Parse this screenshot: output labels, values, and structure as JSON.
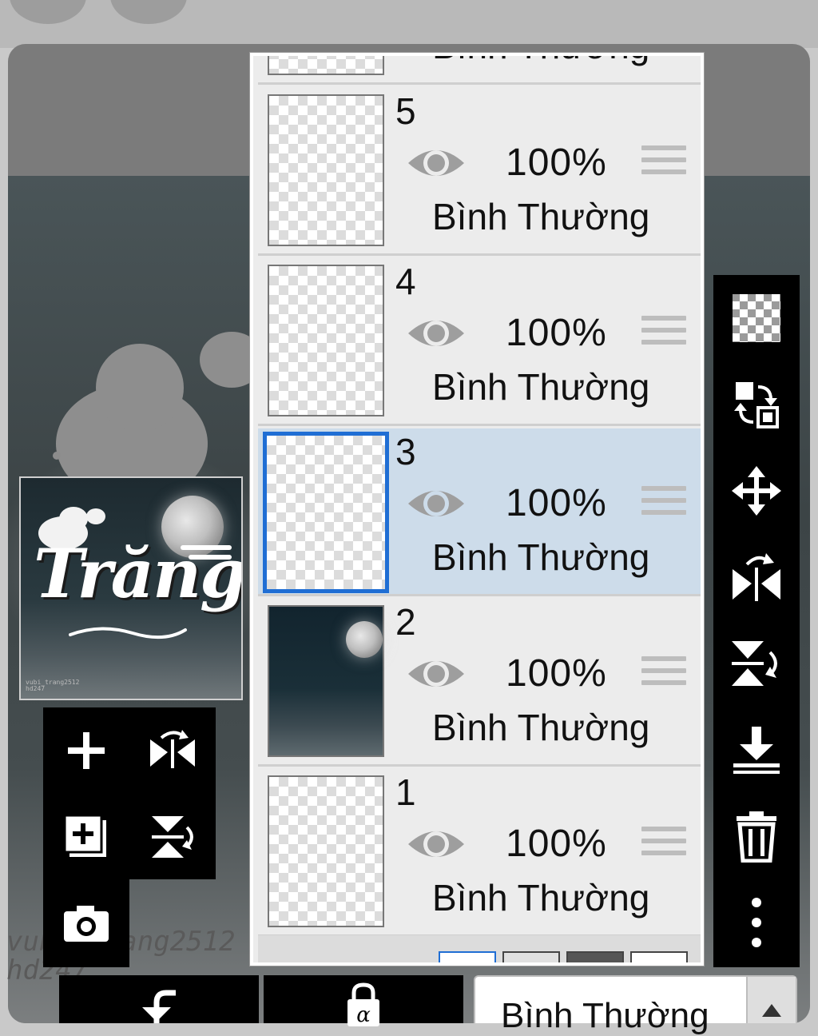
{
  "layers": [
    {
      "number": "5",
      "opacity": "100%",
      "blend": "Bình Thường",
      "visible": true,
      "selected": false
    },
    {
      "number": "4",
      "opacity": "100%",
      "blend": "Bình Thường",
      "visible": true,
      "selected": false
    },
    {
      "number": "3",
      "opacity": "100%",
      "blend": "Bình Thường",
      "visible": true,
      "selected": true
    },
    {
      "number": "2",
      "opacity": "100%",
      "blend": "Bình Thường",
      "visible": true,
      "selected": false
    },
    {
      "number": "1",
      "opacity": "100%",
      "blend": "Bình Thường",
      "visible": true,
      "selected": false
    }
  ],
  "partial_top_layer": {
    "blend": "Bình Thường"
  },
  "preview": {
    "title": "Trăng",
    "credit": "vubi_trang2512\nhd247"
  },
  "background_watermark": "vubi_trang2512\nhd247",
  "blend_select": {
    "value": "Bình Thường"
  },
  "colors": {
    "selected_row": "#cddcea",
    "selected_border": "#1f6ed4",
    "toolbar": "#000000"
  },
  "left_tools": [
    "add-layer-icon",
    "flip-horizontal-icon",
    "add-layer-copy-icon",
    "flip-vertical-icon",
    "camera-icon"
  ],
  "right_tools": [
    "transparency-icon",
    "swap-layers-icon",
    "move-icon",
    "flip-horizontal-icon",
    "flip-vertical-icon",
    "merge-down-icon",
    "trash-icon",
    "more-icon"
  ],
  "bottom_tools": [
    "undo-icon",
    "alpha-lock-icon"
  ]
}
